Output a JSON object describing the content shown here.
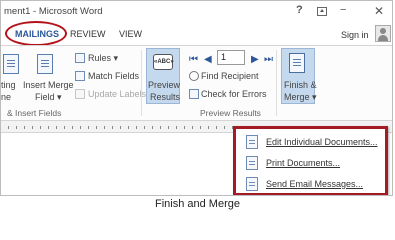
{
  "window": {
    "title": "ment1 - Microsoft Word",
    "controls": {
      "help": "?",
      "minimize": "−",
      "close": "✕"
    }
  },
  "tabs": [
    {
      "label": "MAILINGS",
      "active": true
    },
    {
      "label": "REVIEW"
    },
    {
      "label": "VIEW"
    }
  ],
  "account": {
    "sign_in": "Sign in"
  },
  "ribbon": {
    "insert_fields_group": {
      "label": "& Insert Fields",
      "writing_line_1": "ting",
      "writing_line_2": "ne",
      "insert_merge_line_1": "Insert Merge",
      "insert_merge_line_2": "Field ▾",
      "rules": "Rules ▾",
      "match_fields": "Match Fields",
      "update_labels": "Update Labels"
    },
    "preview_group": {
      "label": "Preview Results",
      "preview_line_1": "Preview",
      "preview_line_2": "Results",
      "record_value": "1",
      "find_recipient": "Find Recipient",
      "check_for_errors": "Check for Errors",
      "abc": "«ABC»"
    },
    "finish_group": {
      "finish_line_1": "Finish &",
      "finish_line_2": "Merge ▾"
    }
  },
  "finish_menu": {
    "items": [
      {
        "label": "Edit Individual Documents..."
      },
      {
        "label": "Print Documents..."
      },
      {
        "label": "Send Email Messages..."
      }
    ]
  },
  "caption": "Finish and Merge",
  "colors": {
    "accent": "#2b579a",
    "highlight_red": "#a31b23",
    "selected_button": "#c5d9ee"
  }
}
